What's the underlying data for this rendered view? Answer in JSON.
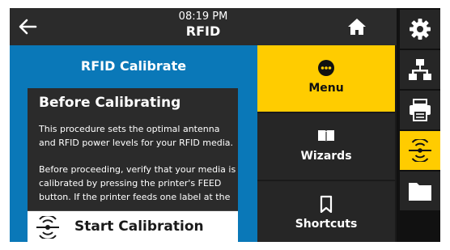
{
  "header": {
    "time": "08:19 PM",
    "title": "RFID"
  },
  "panel": {
    "title": "RFID Calibrate",
    "card_title": "Before Calibrating",
    "paragraph1": "This procedure sets the optimal antenna and RFID power levels for your RFID media.",
    "paragraph2": "Before proceeding, verify that your media is calibrated by pressing the printer's FEED button. If the printer feeds one label at the",
    "start_label": "Start Calibration"
  },
  "middle_menu": [
    {
      "label": "Menu",
      "icon": "menu-dots-icon",
      "active": true
    },
    {
      "label": "Wizards",
      "icon": "book-icon",
      "active": false
    },
    {
      "label": "Shortcuts",
      "icon": "bookmark-icon",
      "active": false
    }
  ],
  "right_nav": [
    {
      "icon": "gear-icon",
      "active": false
    },
    {
      "icon": "network-icon",
      "active": false
    },
    {
      "icon": "printer-icon",
      "active": false
    },
    {
      "icon": "rfid-icon",
      "active": true
    },
    {
      "icon": "folder-icon",
      "active": false
    }
  ],
  "colors": {
    "accent": "#ffcc00",
    "panel_blue": "#0a78b8",
    "dark": "#262626"
  }
}
